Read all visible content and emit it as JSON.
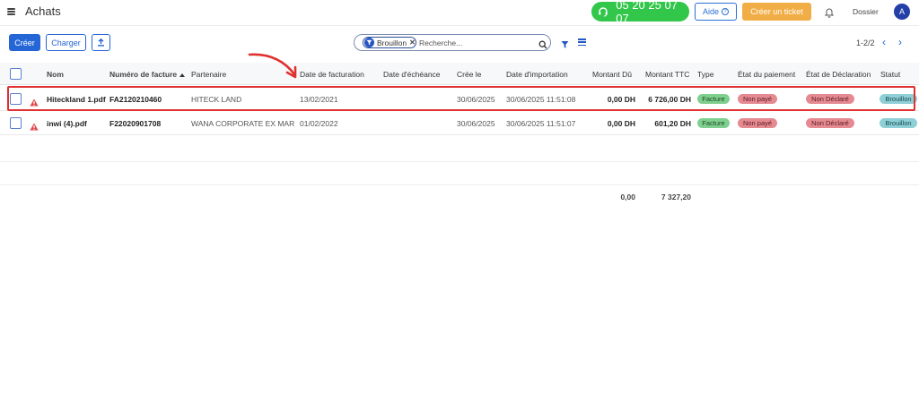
{
  "header": {
    "title": "Achats",
    "phone": "05 20 25 07 07",
    "help_label": "Aide",
    "help_symbol": "?",
    "ticket_label": "Créer un ticket",
    "dossier_label": "Dossier",
    "avatar_letter": "A"
  },
  "toolbar": {
    "create_label": "Créer",
    "load_label": "Charger",
    "search": {
      "filter_chip": "Brouillon",
      "placeholder": "Recherche..."
    },
    "pager": "1-2/2",
    "prev": "‹",
    "next": "›"
  },
  "table": {
    "columns": {
      "nom": "Nom",
      "numero": "Numéro de facture",
      "partenaire": "Partenaire",
      "date_facturation": "Date de facturation",
      "date_echeance": "Date d'échéance",
      "cree_le": "Crée le",
      "date_import": "Date d'importation",
      "montant_du": "Montant Dû",
      "montant_ttc": "Montant TTC",
      "type": "Type",
      "etat_paiement": "État du paiement",
      "etat_declaration": "État de Déclaration",
      "statut": "Statut"
    },
    "rows": [
      {
        "nom": "Hiteckland 1.pdf",
        "numero": "FA2120210460",
        "partenaire": "HITECK LAND",
        "date_facturation": "13/02/2021",
        "date_echeance": "",
        "cree_le": "30/06/2025",
        "date_import": "30/06/2025 11:51:08",
        "montant_du": "0,00 DH",
        "montant_ttc": "6 726,00 DH",
        "type": "Facture",
        "etat_paiement": "Non payé",
        "etat_declaration": "Non Déclaré",
        "statut": "Brouillon"
      },
      {
        "nom": "inwi (4).pdf",
        "numero": "F22020901708",
        "partenaire": "WANA CORPORATE EX MARO...",
        "date_facturation": "01/02/2022",
        "date_echeance": "",
        "cree_le": "30/06/2025",
        "date_import": "30/06/2025 11:51:07",
        "montant_du": "0,00 DH",
        "montant_ttc": "601,20 DH",
        "type": "Facture",
        "etat_paiement": "Non payé",
        "etat_declaration": "Non Déclaré",
        "statut": "Brouillon"
      }
    ],
    "totals": {
      "montant_du": "0,00",
      "montant_ttc": "7 327,20"
    }
  },
  "colors": {
    "primary": "#2466d6",
    "phone_green": "#32c74a",
    "ticket_orange": "#f2ae46",
    "highlight_red": "#e03030",
    "warning_red": "#e04848"
  }
}
